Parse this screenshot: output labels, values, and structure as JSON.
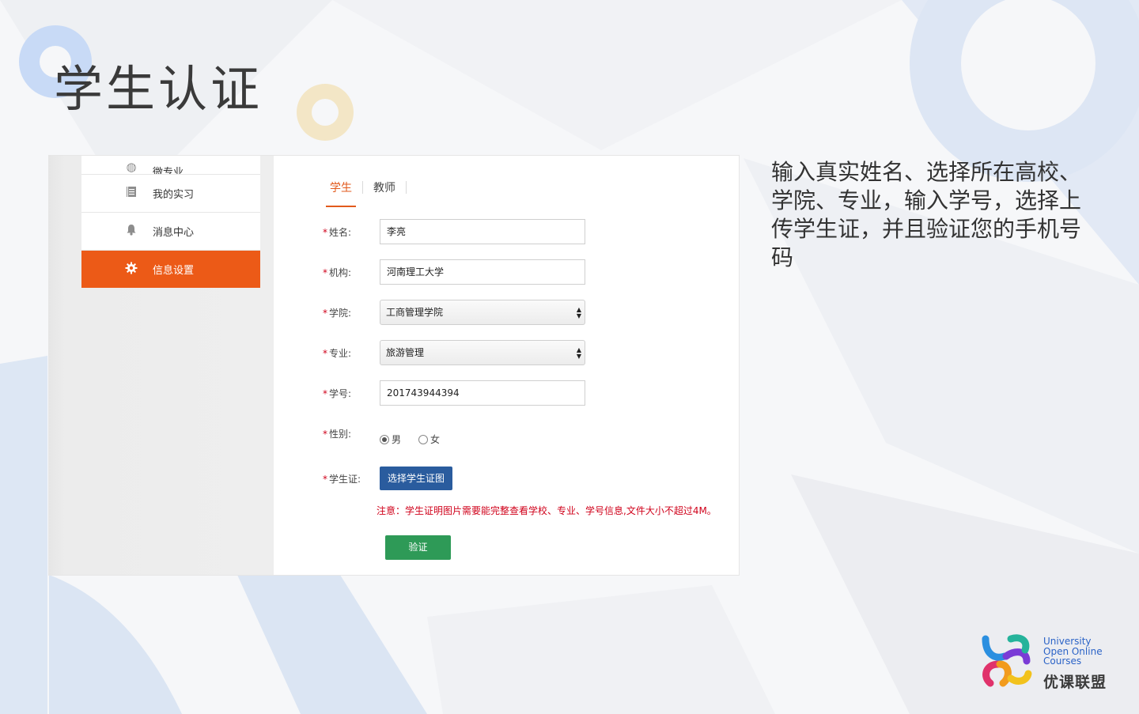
{
  "slide": {
    "title": "学生认证",
    "description": "输入真实姓名、选择所在高校、学院、专业，输入学号，选择上传学生证，并且验证您的手机号码"
  },
  "sidebar": {
    "items": [
      {
        "label": "微专业",
        "icon": "leaf-icon"
      },
      {
        "label": "我的实习",
        "icon": "notebook-icon"
      },
      {
        "label": "消息中心",
        "icon": "bell-icon"
      },
      {
        "label": "信息设置",
        "icon": "gear-icon",
        "active": true
      }
    ]
  },
  "tabs": [
    {
      "label": "学生",
      "active": true
    },
    {
      "label": "教师",
      "active": false
    }
  ],
  "form": {
    "name": {
      "label": "姓名:",
      "value": "李亮"
    },
    "institution": {
      "label": "机构:",
      "value": "河南理工大学"
    },
    "college": {
      "label": "学院:",
      "value": "工商管理学院"
    },
    "major": {
      "label": "专业:",
      "value": "旅游管理"
    },
    "student_id": {
      "label": "学号:",
      "value": "201743944394"
    },
    "gender": {
      "label": "性别:",
      "options": [
        "男",
        "女"
      ],
      "selected": "男"
    },
    "student_card": {
      "label": "学生证:",
      "button": "选择学生证图"
    },
    "note": "注意：学生证明图片需要能完整查看学校、专业、学号信息,文件大小不超过4M。",
    "verify_button": "验证",
    "required_mark": "*"
  },
  "logo": {
    "line1": "University",
    "line2": "Open Online",
    "line3": "Courses",
    "cn": "优课联盟"
  },
  "colors": {
    "accent_orange": "#ec5a17",
    "upload_blue": "#2a5c9e",
    "verify_green": "#2e9a57",
    "required_red": "#d0021b"
  }
}
